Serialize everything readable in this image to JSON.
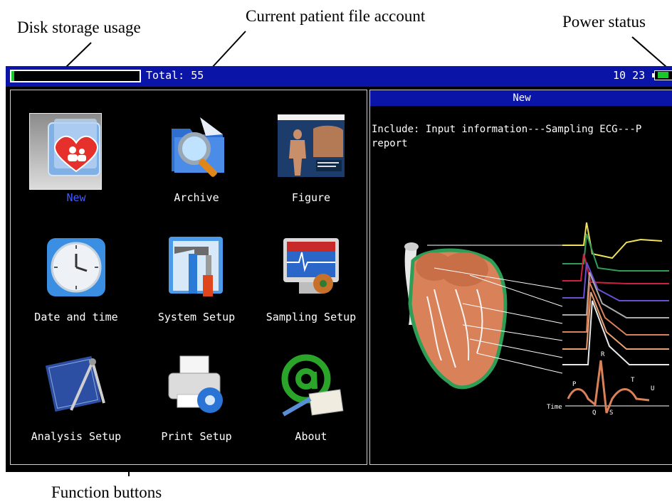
{
  "annotations": {
    "disk_storage": "Disk storage usage",
    "patient_account": "Current patient file account",
    "power_status": "Power status",
    "function_buttons": "Function buttons"
  },
  "status_bar": {
    "total": "Total: 55",
    "time": "10 23",
    "disk_usage_fraction": 0.02,
    "battery_level_fraction": 0.7
  },
  "buttons": [
    {
      "label": "New",
      "icon": "new-patient-folder-icon",
      "selected": true
    },
    {
      "label": "Archive",
      "icon": "archive-magnifier-icon"
    },
    {
      "label": "Figure",
      "icon": "figure-anatomy-icon"
    },
    {
      "label": "Date and time",
      "icon": "clock-icon"
    },
    {
      "label": "System Setup",
      "icon": "tools-icon"
    },
    {
      "label": "Sampling Setup",
      "icon": "sampling-monitor-icon"
    },
    {
      "label": "Analysis Setup",
      "icon": "compass-drawing-icon"
    },
    {
      "label": "Print Setup",
      "icon": "printer-gear-icon"
    },
    {
      "label": "About",
      "icon": "at-sign-icon"
    }
  ],
  "right_panel": {
    "header": "New",
    "description_line1": "Include: Input information---Sampling ECG---P",
    "description_line2": "report"
  },
  "figure": {
    "wave_labels": [
      "P",
      "Q",
      "R",
      "S",
      "T",
      "U"
    ],
    "time_label": "Time"
  },
  "colors": {
    "accent_blue": "#0a14a6",
    "selected_label": "#3f58ff",
    "battery_green": "#19c82a"
  }
}
